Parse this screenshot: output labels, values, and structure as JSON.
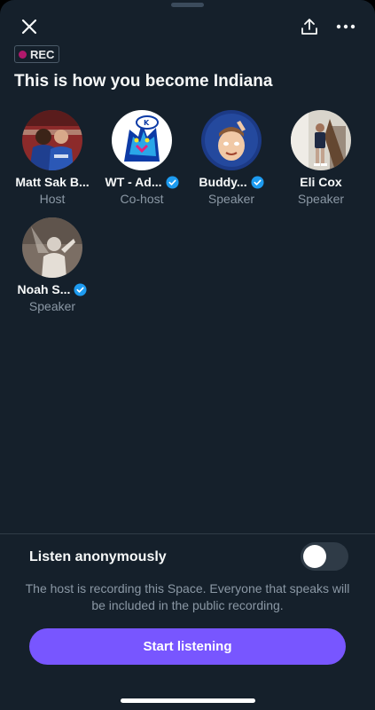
{
  "header": {
    "rec_label": "REC",
    "title": "This is how you become Indiana",
    "icons": [
      "close-icon",
      "share-icon",
      "more-icon"
    ]
  },
  "speakers": [
    {
      "name": "Matt Sak B...",
      "role": "Host",
      "verified": false
    },
    {
      "name": "WT - Ad...",
      "role": "Co-host",
      "verified": true
    },
    {
      "name": "Buddy...",
      "role": "Speaker",
      "verified": true
    },
    {
      "name": "Eli Cox",
      "role": "Speaker",
      "verified": false
    },
    {
      "name": "Noah S...",
      "role": "Speaker",
      "verified": true
    }
  ],
  "bottom": {
    "listen_label": "Listen anonymously",
    "toggle_on": false,
    "notice": "The host is recording this Space. Everyone that speaks will be included in the public recording.",
    "start_label": "Start listening"
  },
  "colors": {
    "background": "#15202b",
    "accent": "#7856ff",
    "verified": "#1d9bf0",
    "rec_dot": "#b0186b"
  }
}
